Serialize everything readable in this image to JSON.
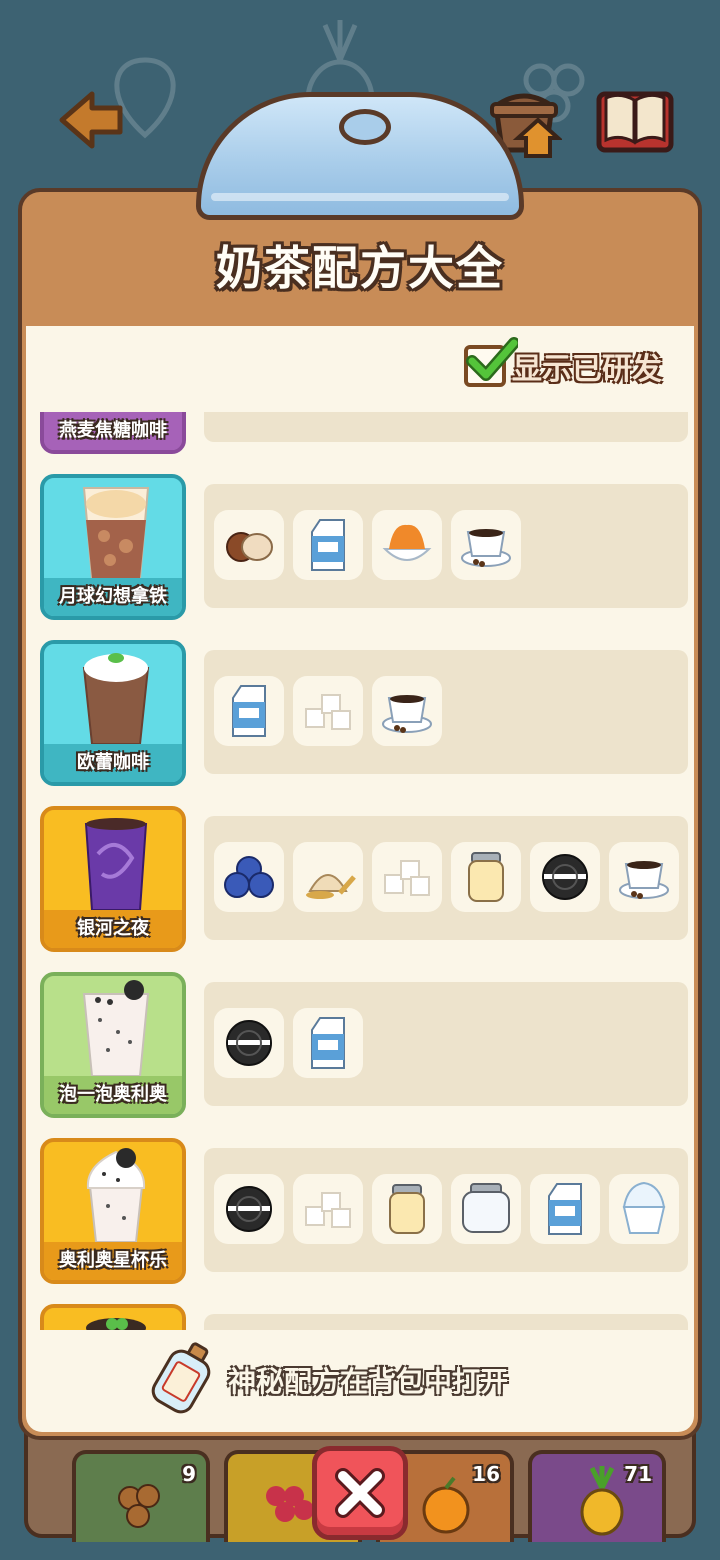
{
  "title": "奶茶配方大全",
  "show_developed": {
    "label": "显示已研发",
    "checked": true
  },
  "recipes": [
    {
      "name": "燕麦焦糖咖啡",
      "color": "#b878c8",
      "ingredients": []
    },
    {
      "name": "月球幻想拿铁",
      "color": "#5fd3dd",
      "ingredients": [
        "hazelnut-icon",
        "milk-carton-icon",
        "caramel-cream-icon",
        "coffee-cup-icon"
      ]
    },
    {
      "name": "欧蕾咖啡",
      "color": "#5fd3dd",
      "ingredients": [
        "milk-carton-icon",
        "sugar-cubes-icon",
        "coffee-cup-icon"
      ]
    },
    {
      "name": "银河之夜",
      "color": "#f7b526",
      "ingredients": [
        "blueberry-icon",
        "oat-flour-icon",
        "sugar-cubes-icon",
        "condensed-milk-jar-icon",
        "oreo-cookie-icon",
        "coffee-cup-icon"
      ]
    },
    {
      "name": "泡一泡奥利奥",
      "color": "#a6d67a",
      "ingredients": [
        "oreo-cookie-icon",
        "milk-carton-icon"
      ]
    },
    {
      "name": "奥利奥星杯乐",
      "color": "#f7b526",
      "ingredients": [
        "oreo-cookie-icon",
        "sugar-cubes-icon",
        "condensed-milk-jar-icon",
        "empty-jar-icon",
        "milk-carton-icon",
        "ice-cream-cup-icon"
      ]
    }
  ],
  "footer_note": "神秘配方在背包中打开",
  "tray_slots": [
    {
      "name": "hazelnuts",
      "count": "9",
      "color": "#5e7e4c"
    },
    {
      "name": "grapes",
      "count": "",
      "color": "#c8a028"
    },
    {
      "name": "orange",
      "count": "16",
      "color": "#b8703a"
    },
    {
      "name": "pineapple",
      "count": "71",
      "color": "#7a4a8a"
    }
  ]
}
